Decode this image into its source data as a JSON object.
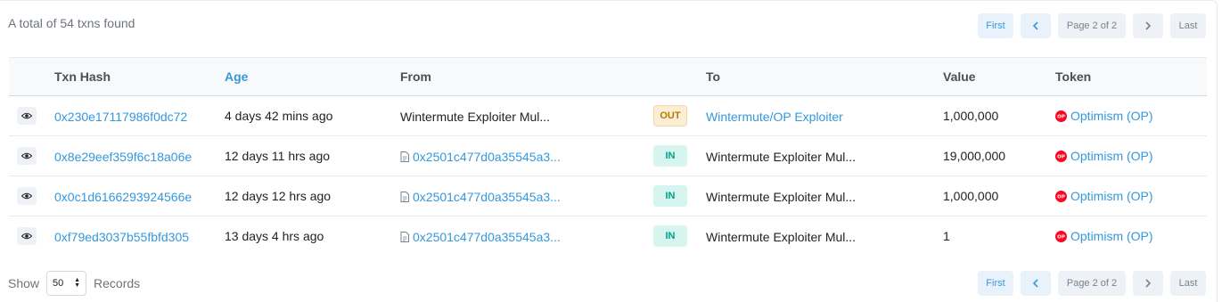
{
  "summary": "A total of 54 txns found",
  "pagination": {
    "first": "First",
    "prev_icon": "chevron-left-icon",
    "page_info": "Page 2 of 2",
    "next_icon": "chevron-right-icon",
    "last": "Last"
  },
  "table": {
    "headers": {
      "txn_hash": "Txn Hash",
      "age": "Age",
      "from": "From",
      "to": "To",
      "value": "Value",
      "token": "Token"
    },
    "rows": [
      {
        "hash": "0x230e17117986f0dc72",
        "age": "4 days 42 mins ago",
        "from": "Wintermute Exploiter Mul...",
        "direction": "OUT",
        "to": "Wintermute/OP Exploiter",
        "value": "1,000,000",
        "token": "Optimism (OP)"
      },
      {
        "hash": "0x8e29eef359f6c18a06e",
        "age": "12 days 11 hrs ago",
        "from": "0x2501c477d0a35545a3...",
        "direction": "IN",
        "to": "Wintermute Exploiter Mul...",
        "value": "19,000,000",
        "token": "Optimism (OP)"
      },
      {
        "hash": "0x0c1d6166293924566e",
        "age": "12 days 12 hrs ago",
        "from": "0x2501c477d0a35545a3...",
        "direction": "IN",
        "to": "Wintermute Exploiter Mul...",
        "value": "1,000,000",
        "token": "Optimism (OP)"
      },
      {
        "hash": "0xf79ed3037b55fbfd305",
        "age": "13 days 4 hrs ago",
        "from": "0x2501c477d0a35545a3...",
        "direction": "IN",
        "to": "Wintermute Exploiter Mul...",
        "value": "1",
        "token": "Optimism (OP)"
      }
    ]
  },
  "footer": {
    "show_label": "Show",
    "records_value": "50",
    "records_label": "Records"
  },
  "colors": {
    "link": "#3498db",
    "out_badge": "#fbeed5",
    "in_badge": "#d6f5ef",
    "token_icon": "#ff0420"
  }
}
